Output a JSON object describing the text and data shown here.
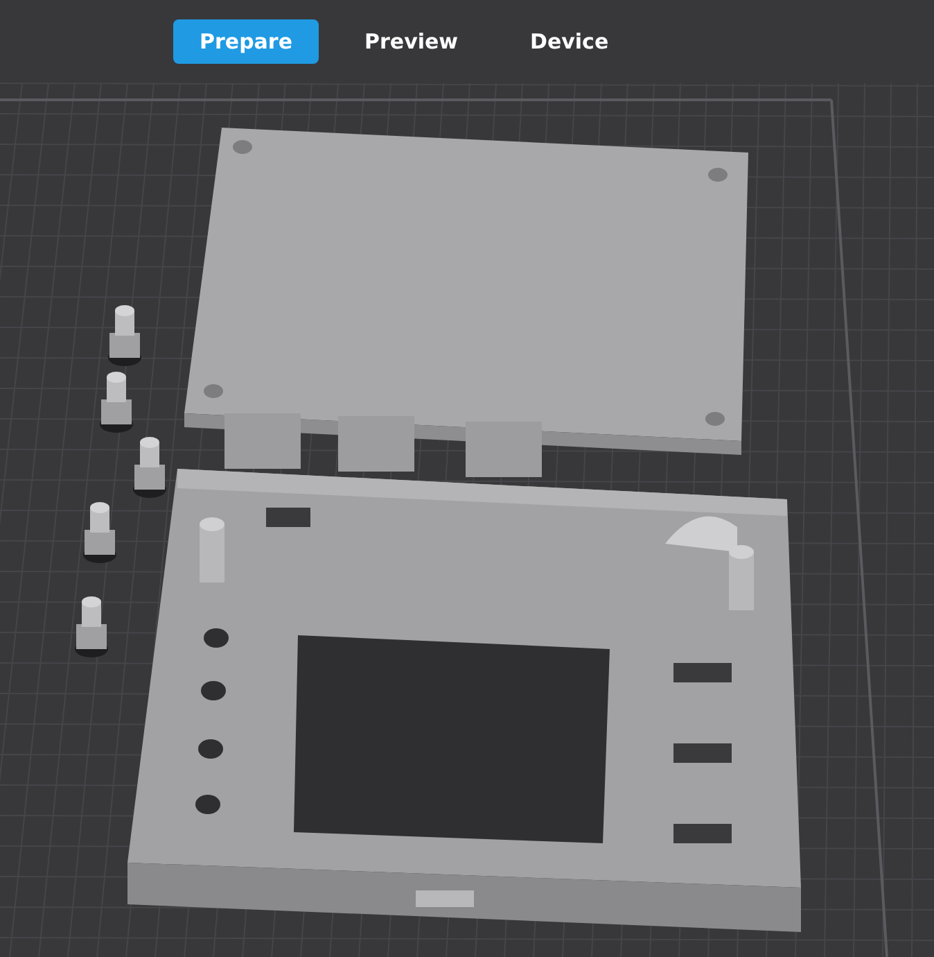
{
  "tabs": [
    {
      "label": "Prepare",
      "selected": true
    },
    {
      "label": "Preview",
      "selected": false
    },
    {
      "label": "Device",
      "selected": false
    }
  ]
}
